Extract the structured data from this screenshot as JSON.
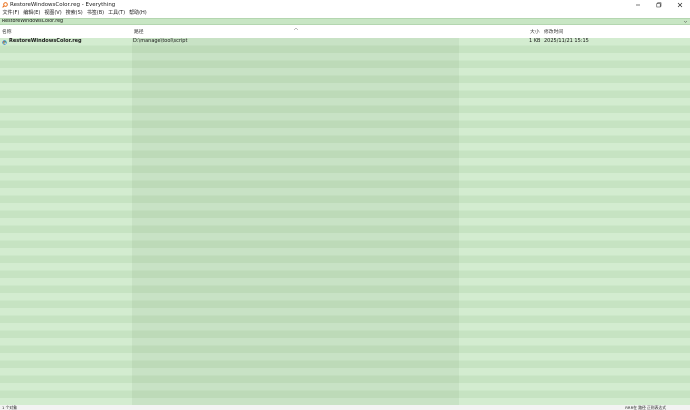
{
  "window": {
    "title": "RestoreWindowsColor.reg - Everything",
    "controls": {
      "minimize": "—",
      "maximize": "☐",
      "close": "✕"
    }
  },
  "menu": {
    "items": [
      {
        "label": "文件(F)"
      },
      {
        "label": "编辑(E)"
      },
      {
        "label": "视图(V)"
      },
      {
        "label": "搜索(S)"
      },
      {
        "label": "书签(B)"
      },
      {
        "label": "工具(T)"
      },
      {
        "label": "帮助(H)"
      }
    ]
  },
  "search": {
    "value": "RestoreWindowsColor.reg",
    "dropdown_icon": "chevron-down"
  },
  "columns": {
    "name": "名称",
    "path": "路径",
    "size": "大小",
    "modified": "修改时间"
  },
  "results": [
    {
      "name": "RestoreWindowsColor.reg",
      "path": "D:\\manage\\tool\\script",
      "size": "1 KB",
      "modified": "2025/11/21 15:15",
      "icon": "reg-file-icon"
    }
  ],
  "status": {
    "count": "1 个对象",
    "right": "RRR在 路径 正则表达式"
  },
  "colors": {
    "row_light": "#d3ecd0",
    "row_dark": "#c6e3c2",
    "search_bg": "#c8e6c4",
    "accent": "#e8650a"
  }
}
